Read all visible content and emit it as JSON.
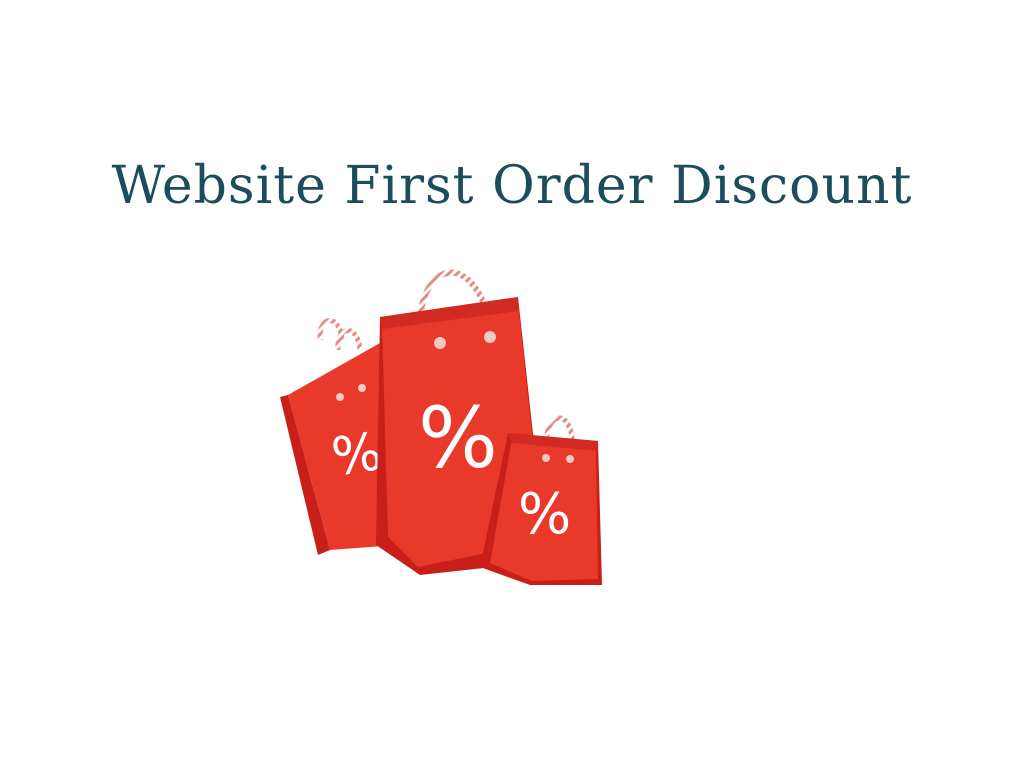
{
  "title": "Website First Order Discount",
  "illustration": {
    "name": "shopping-bags-with-percent-signs",
    "bag_symbol": "%",
    "colors": {
      "bag_front": "#e8392a",
      "bag_side": "#c81f1a",
      "bag_dark": "#a51612",
      "handle": "#f2b8b0",
      "title": "#1b4d5c"
    }
  }
}
